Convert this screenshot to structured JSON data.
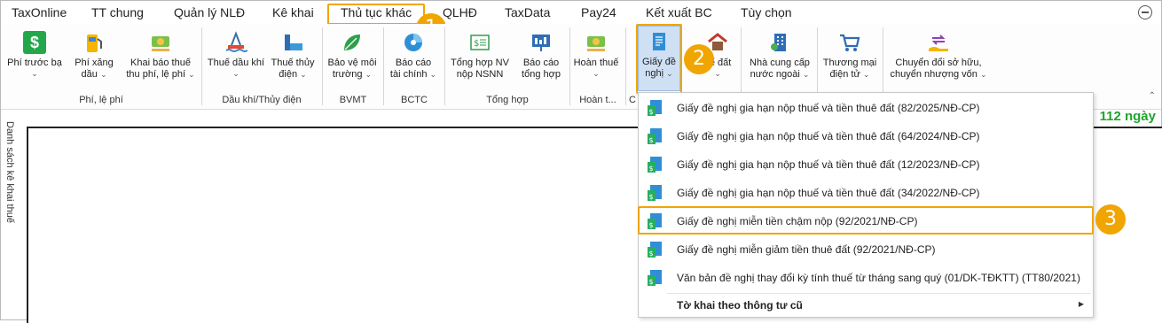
{
  "menu": {
    "items": [
      "TaxOnline",
      "TT chung",
      "Quản lý NLĐ",
      "Kê khai",
      "Thủ tục khác",
      "QLHĐ",
      "TaxData",
      "Pay24",
      "Kết xuất BC",
      "Tùy chọn"
    ]
  },
  "badges": [
    "1",
    "2",
    "3"
  ],
  "ribbon": {
    "buttons": [
      {
        "label1": "Phí trước bạ",
        "label2": ""
      },
      {
        "label1": "Phí xăng",
        "label2": "dầu"
      },
      {
        "label1": "Khai báo thuế",
        "label2": "thu phí, lệ phí"
      },
      {
        "label1": "Thuế dầu khí",
        "label2": ""
      },
      {
        "label1": "Thuế thủy",
        "label2": "điện"
      },
      {
        "label1": "Bảo vệ môi",
        "label2": "trường"
      },
      {
        "label1": "Báo cáo",
        "label2": "tài chính"
      },
      {
        "label1": "Tổng hợp NV",
        "label2": "nộp NSNN"
      },
      {
        "label1": "Báo cáo",
        "label2": "tổng hợp"
      },
      {
        "label1": "Hoàn thuế",
        "label2": ""
      },
      {
        "label1": "Giấy đề",
        "label2": "nghị"
      },
      {
        "label1": "uế đất",
        "label2": ""
      },
      {
        "label1": "Nhà cung cấp",
        "label2": "nước ngoài"
      },
      {
        "label1": "Thương mại",
        "label2": "điện tử"
      },
      {
        "label1": "Chuyển đổi sở hữu,",
        "label2": "chuyển nhượng vốn"
      }
    ],
    "groups": [
      "Phí, lệ phí",
      "Dầu khí/Thủy điện",
      "BVMT",
      "BCTC",
      "Tổng hợp",
      "Hoàn t...",
      "C"
    ]
  },
  "side_panel": {
    "title": "Danh sách kê khai thuế"
  },
  "days_left": "112 ngày",
  "dropdown": {
    "items": [
      "Giấy đề nghị gia hạn nộp thuế và tiền thuê đất (82/2025/NĐ-CP)",
      "Giấy đề nghị gia hạn nộp thuế và tiền thuê đất (64/2024/NĐ-CP)",
      "Giấy đề nghị gia hạn nộp thuế và tiền thuê đất (12/2023/NĐ-CP)",
      "Giấy đề nghị gia hạn nộp thuế và tiền thuê đất (34/2022/NĐ-CP)",
      "Giấy đề nghị miễn tiền chậm nộp (92/2021/NĐ-CP)",
      "Giấy đề nghị miễn giảm tiền thuê đất (92/2021/NĐ-CP)",
      "Văn bản đề nghị thay đổi kỳ tính thuế từ tháng sang quý (01/DK-TĐKTT) (TT80/2021)"
    ],
    "submenu_label": "Tờ khai theo thông tư cũ"
  },
  "colors": {
    "highlight": "#f0a500",
    "days_green": "#1fa32e",
    "icon_green": "#22a84a"
  }
}
